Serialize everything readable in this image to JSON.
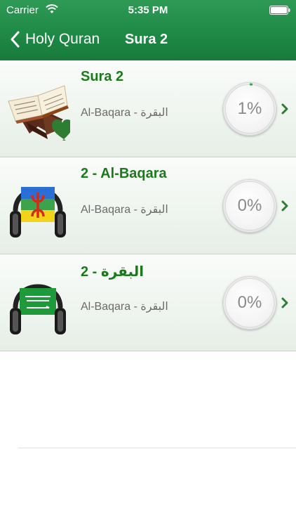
{
  "status_bar": {
    "carrier": "Carrier",
    "time": "5:35 PM"
  },
  "nav": {
    "back_label": "Holy Quran",
    "title": "Sura 2"
  },
  "rows": [
    {
      "title": "Sura 2",
      "subtitle": "Al-Baqara - البقرة",
      "progress": "1%",
      "progress_value": 0.01,
      "icon": "quran-book-icon",
      "favorite": true
    },
    {
      "title": "2 - Al-Baqara",
      "subtitle": "Al-Baqara - البقرة",
      "progress": "0%",
      "progress_value": 0,
      "icon": "amazigh-flag-headphones-icon"
    },
    {
      "title": "2 - البقرة",
      "subtitle": "Al-Baqara - البقرة",
      "progress": "0%",
      "progress_value": 0,
      "icon": "saudi-flag-headphones-icon"
    }
  ],
  "colors": {
    "header": "#1f8a46",
    "title_text": "#1c7a1c",
    "favorite": "#2e7d32"
  }
}
